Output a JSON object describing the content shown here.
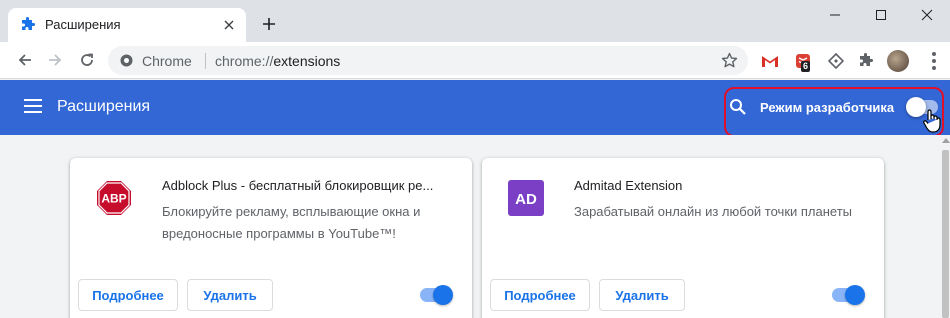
{
  "tab": {
    "title": "Расширения",
    "close_glyph": "✕",
    "icon": "puzzle-icon"
  },
  "newtab": {
    "glyph": "+"
  },
  "window": {
    "minimize": "—",
    "maximize": "☐",
    "close": "✕"
  },
  "toolbar": {
    "back": "←",
    "forward": "→",
    "reload": "↻",
    "chip": "Chrome",
    "url_prefix": "chrome://",
    "url_path": "extensions",
    "star": "☆",
    "todoist_badge": "6"
  },
  "header": {
    "title": "Расширения",
    "dev_mode_label": "Режим разработчика",
    "dev_mode_on": false
  },
  "cards": [
    {
      "name": "Adblock Plus - бесплатный блокировщик ре...",
      "description": "Блокируйте рекламу, всплывающие окна и вредоносные программы в YouTube™!",
      "logo_text": "ABP",
      "details_label": "Подробнее",
      "remove_label": "Удалить",
      "enabled": true
    },
    {
      "name": "Admitad Extension",
      "description": "Зарабатывай онлайн из любой точки планеты",
      "logo_text": "AD",
      "details_label": "Подробнее",
      "remove_label": "Удалить",
      "enabled": true
    }
  ],
  "colors": {
    "header_bg": "#3367d6",
    "accent": "#1a73e8",
    "highlight_border": "#e0102b",
    "abp_red": "#c70d2c",
    "admitad_purple": "#7a3fc5"
  }
}
